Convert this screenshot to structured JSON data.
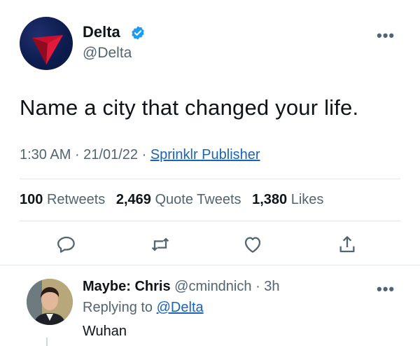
{
  "tweet": {
    "author_name": "Delta",
    "author_handle": "@Delta",
    "more_label": "•••",
    "text": "Name a city that changed your life.",
    "time": "1:30 AM",
    "date": "21/01/22",
    "separator": " · ",
    "source": "Sprinklr Publisher",
    "stats": {
      "retweets_count": "100",
      "retweets_label": "Retweets",
      "quotes_count": "2,469",
      "quotes_label": "Quote Tweets",
      "likes_count": "1,380",
      "likes_label": "Likes"
    },
    "actions": [
      "reply-icon",
      "retweet-icon",
      "like-icon",
      "share-icon"
    ]
  },
  "reply": {
    "author_name": "Maybe: Chris",
    "author_handle": "@cmindnich",
    "time_ago": "· 3h",
    "replying_prefix": "Replying to ",
    "replying_to": "@Delta",
    "text": "Wuhan",
    "more_label": "•••"
  },
  "colors": {
    "verified": "#1d9bf0",
    "link": "#1d63b3",
    "secondary_text": "#536471",
    "delta_red": "#c8102e",
    "delta_navy": "#0c1b4d"
  }
}
